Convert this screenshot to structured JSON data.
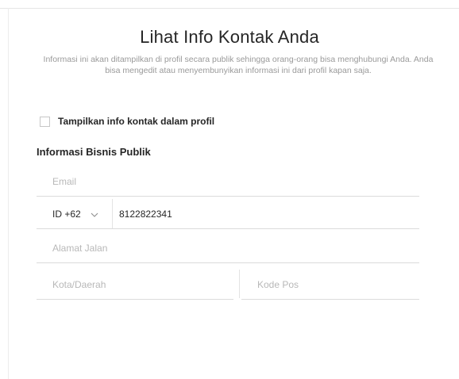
{
  "header": {
    "title": "Lihat Info Kontak Anda",
    "subtitle": "Informasi ini akan ditampilkan di profil secara publik sehingga orang-orang bisa menghubungi Anda. Anda bisa mengedit atau menyembunyikan informasi ini dari profil kapan saja."
  },
  "options": {
    "show_contact_label": "Tampilkan info kontak dalam profil",
    "show_contact_checked": false
  },
  "business": {
    "section_title": "Informasi Bisnis Publik",
    "email_placeholder": "Email",
    "email_value": "",
    "country_code": "ID +62",
    "phone_value": "8122822341",
    "street_placeholder": "Alamat Jalan",
    "city_placeholder": "Kota/Daerah",
    "zip_placeholder": "Kode Pos"
  }
}
